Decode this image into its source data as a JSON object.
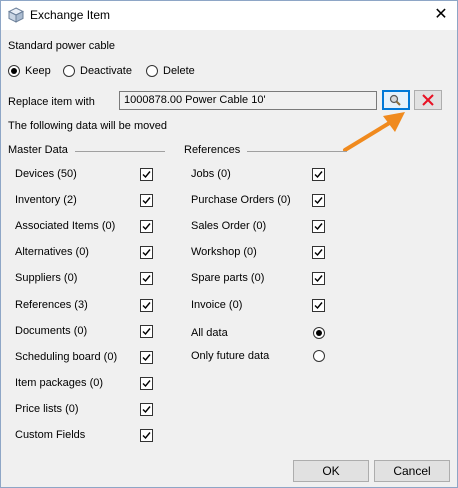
{
  "window": {
    "title": "Exchange Item"
  },
  "item_name": "Standard power cable",
  "action": {
    "options": [
      "Keep",
      "Deactivate",
      "Delete"
    ],
    "selected": "Keep"
  },
  "replace": {
    "label": "Replace item with",
    "value": "1000878.00 Power Cable 10'"
  },
  "info_text": "The following data will be moved",
  "master_data": {
    "title": "Master Data",
    "items": [
      {
        "label": "Devices (50)",
        "checked": true
      },
      {
        "label": "Inventory (2)",
        "checked": true
      },
      {
        "label": "Associated Items (0)",
        "checked": true
      },
      {
        "label": "Alternatives (0)",
        "checked": true
      },
      {
        "label": "Suppliers (0)",
        "checked": true
      },
      {
        "label": "References (3)",
        "checked": true
      },
      {
        "label": "Documents (0)",
        "checked": true
      },
      {
        "label": "Scheduling board (0)",
        "checked": true
      },
      {
        "label": "Item packages (0)",
        "checked": true
      },
      {
        "label": "Price lists (0)",
        "checked": true
      },
      {
        "label": "Custom Fields",
        "checked": true
      }
    ]
  },
  "references": {
    "title": "References",
    "items": [
      {
        "label": "Jobs (0)",
        "checked": true
      },
      {
        "label": "Purchase Orders (0)",
        "checked": true
      },
      {
        "label": "Sales Order (0)",
        "checked": true
      },
      {
        "label": "Workshop (0)",
        "checked": true
      },
      {
        "label": "Spare parts (0)",
        "checked": true
      },
      {
        "label": "Invoice (0)",
        "checked": true
      }
    ],
    "scope_options": [
      "All data",
      "Only future data"
    ],
    "scope_selected": "All data"
  },
  "buttons": {
    "ok": "OK",
    "cancel": "Cancel"
  },
  "colors": {
    "accent": "#0078d7",
    "arrow": "#f08a1e",
    "clear": "#e81123"
  }
}
